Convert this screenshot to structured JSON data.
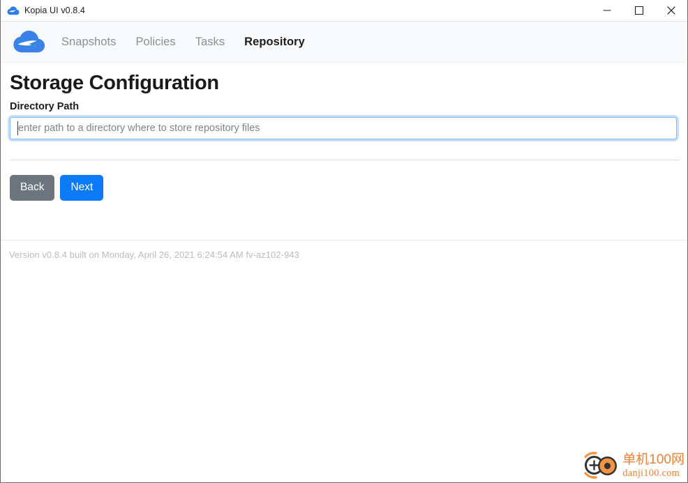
{
  "window": {
    "title": "Kopia UI v0.8.4",
    "app_icon": "cloud-icon",
    "controls": {
      "minimize_label": "—",
      "maximize_label": "□",
      "close_label": "✕"
    }
  },
  "nav": {
    "brand_icon": "kopia-cloud-logo",
    "items": [
      {
        "label": "Snapshots",
        "active": false
      },
      {
        "label": "Policies",
        "active": false
      },
      {
        "label": "Tasks",
        "active": false
      },
      {
        "label": "Repository",
        "active": true
      }
    ]
  },
  "main": {
    "page_title": "Storage Configuration",
    "field": {
      "label": "Directory Path",
      "value": "",
      "placeholder": "enter path to a directory where to store repository files",
      "focused": true
    },
    "buttons": {
      "back_label": "Back",
      "next_label": "Next"
    }
  },
  "footer": {
    "version_text": "Version v0.8.4 built on Monday, April 26, 2021 6:24:54 AM fv-az102-943"
  },
  "watermark": {
    "logo_icon": "danji100-logo",
    "cn_text": "单机100网",
    "url_text": "danji100.com",
    "color": "#f07c2a"
  },
  "colors": {
    "accent_blue": "#0d7bf7",
    "secondary_gray": "#6c757d",
    "navbar_bg": "#f8f9fa",
    "focus_border": "#86b7fe",
    "kopia_blue": "#3b82e8",
    "muted_text": "#b9bcc0"
  }
}
